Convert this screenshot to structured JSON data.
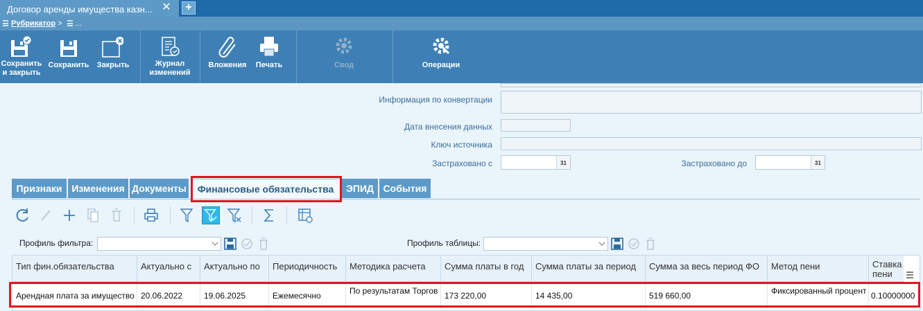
{
  "window": {
    "tab_title": "Договор аренды имущества казн...",
    "close_glyph": "✕",
    "new_tab_glyph": "+"
  },
  "breadcrumb": {
    "root": "Рубрикатор",
    "separator": ">",
    "current": "..."
  },
  "toolbar": {
    "save_close": "Сохранить и закрыть",
    "save": "Сохранить",
    "close": "Закрыть",
    "journal": "Журнал изменений",
    "attachments": "Вложения",
    "print": "Печать",
    "summary": "Свод",
    "operations": "Операции"
  },
  "form": {
    "conversion_info_label": "Информация по конвертации",
    "entry_date_label": "Дата внесения данных",
    "source_key_label": "Ключ источника",
    "insured_from_label": "Застраховано с",
    "insured_to_label": "Застраховано до",
    "calendar_glyph": "31"
  },
  "tabs": [
    {
      "label": "Признаки",
      "active": false
    },
    {
      "label": "Изменения",
      "active": false
    },
    {
      "label": "Документы",
      "active": false
    },
    {
      "label": "Финансовые обязательства",
      "active": true
    },
    {
      "label": "ЭПИД",
      "active": false
    },
    {
      "label": "События",
      "active": false
    }
  ],
  "profiles": {
    "filter_label": "Профиль фильтра:",
    "table_label": "Профиль таблицы:"
  },
  "table": {
    "columns": [
      "Тип фин.обязательства",
      "Актуально с",
      "Актуально по",
      "Периодичность",
      "Методика расчета",
      "Сумма платы в год",
      "Сумма платы за период",
      "Сумма за весь период ФО",
      "Метод пени",
      "Ставка пени"
    ],
    "rows": [
      [
        "Арендная плата за имущество",
        "20.06.2022",
        "19.06.2025",
        "Ежемесячно",
        "По результатам Торгов",
        "173 220,00",
        "14 435,00",
        "519 660,00",
        "Фиксированный процент",
        "0.10000000"
      ]
    ]
  },
  "colors": {
    "accent": "#3e80b5",
    "highlight": "#e0151f",
    "selected_tool": "#32b8e8"
  }
}
